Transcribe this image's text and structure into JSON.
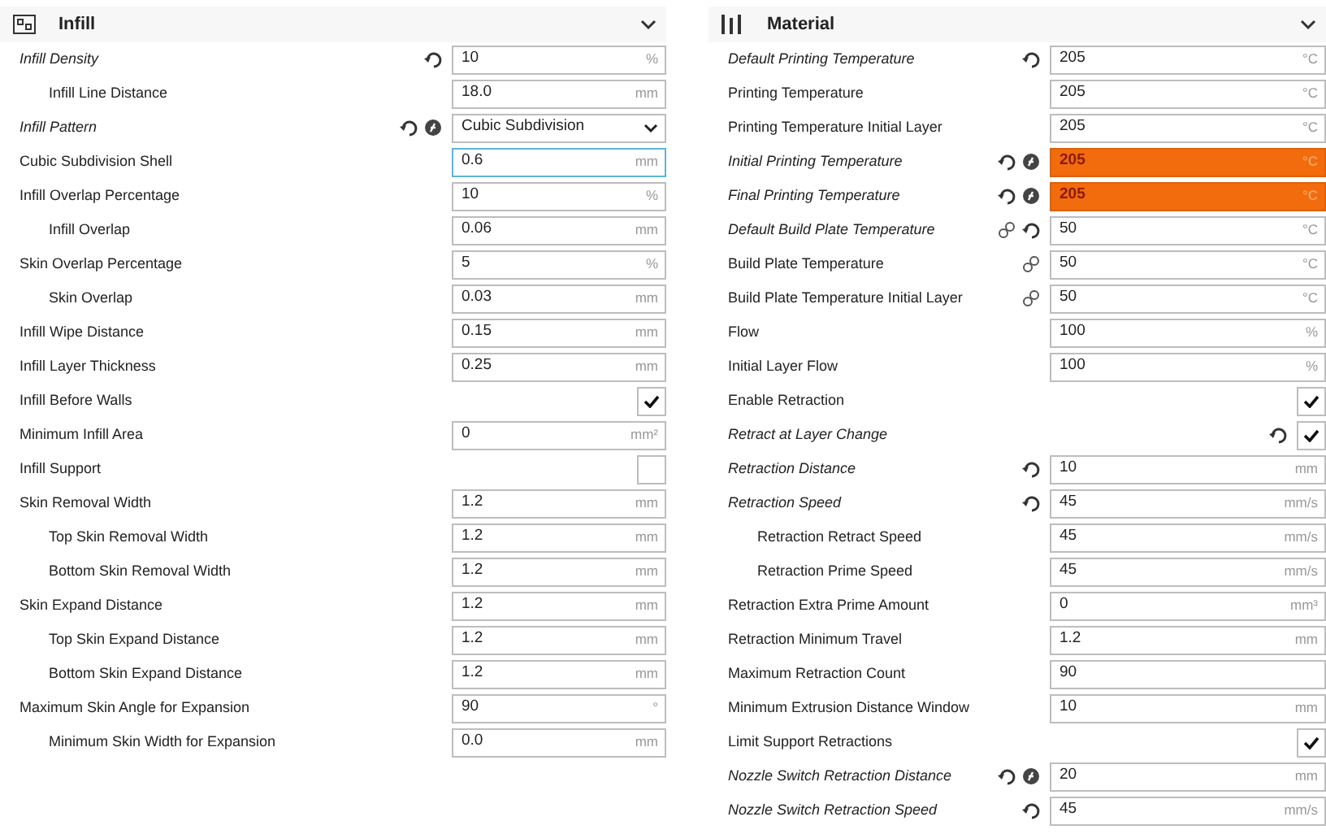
{
  "panels": [
    {
      "title": "Infill",
      "settings": [
        {
          "label": "Infill Density",
          "modified": true,
          "kind": "number",
          "value": "10",
          "unit": "%",
          "resettable": true,
          "children": [
            {
              "label": "Infill Line Distance",
              "modified": false,
              "kind": "number",
              "value": "18.0",
              "unit": "mm"
            }
          ]
        },
        {
          "label": "Infill Pattern",
          "modified": true,
          "kind": "select",
          "value": "Cubic Subdivision",
          "resettable": true,
          "has_function": true
        },
        {
          "label": "Cubic Subdivision Shell",
          "modified": false,
          "kind": "number",
          "value": "0.6",
          "unit": "mm",
          "focused": true
        },
        {
          "label": "Infill Overlap Percentage",
          "modified": false,
          "kind": "number",
          "value": "10",
          "unit": "%",
          "children": [
            {
              "label": "Infill Overlap",
              "modified": false,
              "kind": "number",
              "value": "0.06",
              "unit": "mm"
            }
          ]
        },
        {
          "label": "Skin Overlap Percentage",
          "modified": false,
          "kind": "number",
          "value": "5",
          "unit": "%",
          "children": [
            {
              "label": "Skin Overlap",
              "modified": false,
              "kind": "number",
              "value": "0.03",
              "unit": "mm"
            }
          ]
        },
        {
          "label": "Infill Wipe Distance",
          "modified": false,
          "kind": "number",
          "value": "0.15",
          "unit": "mm"
        },
        {
          "label": "Infill Layer Thickness",
          "modified": false,
          "kind": "number",
          "value": "0.25",
          "unit": "mm"
        },
        {
          "label": "Infill Before Walls",
          "modified": false,
          "kind": "checkbox",
          "checked": true
        },
        {
          "label": "Minimum Infill Area",
          "modified": false,
          "kind": "number",
          "value": "0",
          "unit": "mm²"
        },
        {
          "label": "Infill Support",
          "modified": false,
          "kind": "checkbox",
          "checked": false
        },
        {
          "label": "Skin Removal Width",
          "modified": false,
          "kind": "number",
          "value": "1.2",
          "unit": "mm",
          "children": [
            {
              "label": "Top Skin Removal Width",
              "modified": false,
              "kind": "number",
              "value": "1.2",
              "unit": "mm"
            },
            {
              "label": "Bottom Skin Removal Width",
              "modified": false,
              "kind": "number",
              "value": "1.2",
              "unit": "mm"
            }
          ]
        },
        {
          "label": "Skin Expand Distance",
          "modified": false,
          "kind": "number",
          "value": "1.2",
          "unit": "mm",
          "children": [
            {
              "label": "Top Skin Expand Distance",
              "modified": false,
              "kind": "number",
              "value": "1.2",
              "unit": "mm"
            },
            {
              "label": "Bottom Skin Expand Distance",
              "modified": false,
              "kind": "number",
              "value": "1.2",
              "unit": "mm"
            }
          ]
        },
        {
          "label": "Maximum Skin Angle for Expansion",
          "modified": false,
          "kind": "number",
          "value": "90",
          "unit": "°",
          "children": [
            {
              "label": "Minimum Skin Width for Expansion",
              "modified": false,
              "kind": "number",
              "value": "0.0",
              "unit": "mm"
            }
          ]
        }
      ]
    },
    {
      "title": "Material",
      "settings": [
        {
          "label": "Default Printing Temperature",
          "modified": true,
          "kind": "number",
          "value": "205",
          "unit": "°C",
          "resettable": true
        },
        {
          "label": "Printing Temperature",
          "modified": false,
          "kind": "number",
          "value": "205",
          "unit": "°C"
        },
        {
          "label": "Printing Temperature Initial Layer",
          "modified": false,
          "kind": "number",
          "value": "205",
          "unit": "°C"
        },
        {
          "label": "Initial Printing Temperature",
          "modified": true,
          "kind": "number",
          "value": "205",
          "unit": "°C",
          "resettable": true,
          "has_function": true,
          "error": true
        },
        {
          "label": "Final Printing Temperature",
          "modified": true,
          "kind": "number",
          "value": "205",
          "unit": "°C",
          "resettable": true,
          "has_function": true,
          "error": true
        },
        {
          "label": "Default Build Plate Temperature",
          "modified": true,
          "kind": "number",
          "value": "50",
          "unit": "°C",
          "linked": true,
          "resettable": true
        },
        {
          "label": "Build Plate Temperature",
          "modified": false,
          "kind": "number",
          "value": "50",
          "unit": "°C",
          "linked": true
        },
        {
          "label": "Build Plate Temperature Initial Layer",
          "modified": false,
          "kind": "number",
          "value": "50",
          "unit": "°C",
          "linked": true
        },
        {
          "label": "Flow",
          "modified": false,
          "kind": "number",
          "value": "100",
          "unit": "%"
        },
        {
          "label": "Initial Layer Flow",
          "modified": false,
          "kind": "number",
          "value": "100",
          "unit": "%"
        },
        {
          "label": "Enable Retraction",
          "modified": false,
          "kind": "checkbox",
          "checked": true
        },
        {
          "label": "Retract at Layer Change",
          "modified": true,
          "kind": "checkbox",
          "checked": true,
          "resettable": true
        },
        {
          "label": "Retraction Distance",
          "modified": true,
          "kind": "number",
          "value": "10",
          "unit": "mm",
          "resettable": true
        },
        {
          "label": "Retraction Speed",
          "modified": true,
          "kind": "number",
          "value": "45",
          "unit": "mm/s",
          "resettable": true,
          "children": [
            {
              "label": "Retraction Retract Speed",
              "modified": false,
              "kind": "number",
              "value": "45",
              "unit": "mm/s"
            },
            {
              "label": "Retraction Prime Speed",
              "modified": false,
              "kind": "number",
              "value": "45",
              "unit": "mm/s"
            }
          ]
        },
        {
          "label": "Retraction Extra Prime Amount",
          "modified": false,
          "kind": "number",
          "value": "0",
          "unit": "mm³"
        },
        {
          "label": "Retraction Minimum Travel",
          "modified": false,
          "kind": "number",
          "value": "1.2",
          "unit": "mm"
        },
        {
          "label": "Maximum Retraction Count",
          "modified": false,
          "kind": "number",
          "value": "90"
        },
        {
          "label": "Minimum Extrusion Distance Window",
          "modified": false,
          "kind": "number",
          "value": "10",
          "unit": "mm"
        },
        {
          "label": "Limit Support Retractions",
          "modified": false,
          "kind": "checkbox",
          "checked": true
        },
        {
          "label": "Nozzle Switch Retraction Distance",
          "modified": true,
          "kind": "number",
          "value": "20",
          "unit": "mm",
          "resettable": true,
          "has_function": true
        },
        {
          "label": "Nozzle Switch Retraction Speed",
          "modified": true,
          "kind": "number",
          "value": "45",
          "unit": "mm/s",
          "resettable": true
        }
      ]
    }
  ]
}
